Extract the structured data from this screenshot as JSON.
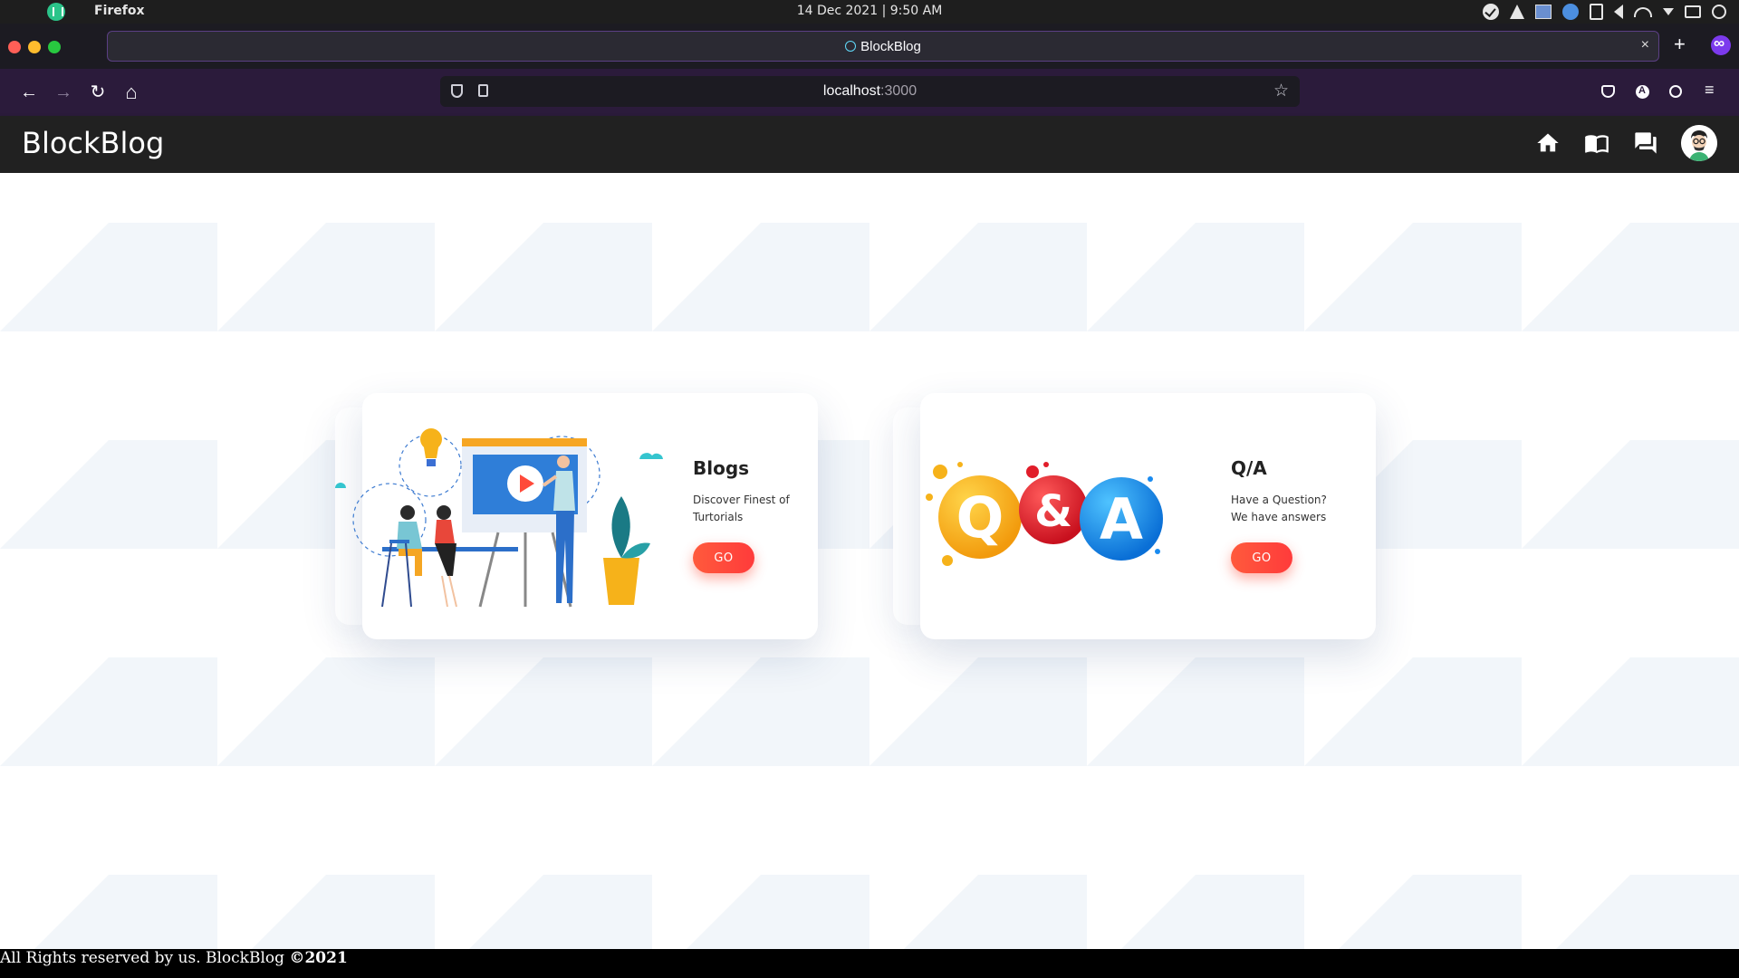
{
  "os": {
    "app_name": "Firefox",
    "clock": "14 Dec 2021 | 9:50 AM",
    "tray_icons": [
      "check-circle-icon",
      "vlc-cone-icon",
      "image-icon",
      "globe-icon",
      "clipboard-icon",
      "volume-icon",
      "wifi-icon",
      "dropdown-arrow-icon",
      "keyboard-icon",
      "power-icon"
    ]
  },
  "browser": {
    "tab_title": "BlockBlog",
    "tab_close": "×",
    "new_tab": "+",
    "url_host": "localhost",
    "url_port": ":3000",
    "back": "←",
    "forward": "→",
    "reload": "↻",
    "home": "⌂",
    "star": "☆",
    "menu": "≡"
  },
  "header": {
    "brand": "BlockBlog",
    "nav_icons": [
      "home-icon",
      "book-icon",
      "forum-icon",
      "avatar"
    ]
  },
  "cards": [
    {
      "title": "Blogs",
      "description": "Discover Finest of Turtorials",
      "button": "GO",
      "illustration": "presentation-meeting-illustration"
    },
    {
      "title": "Q/A",
      "description": "Have a Question? We have answers",
      "button": "GO",
      "illustration": "q-and-a-bubbles-illustration"
    }
  ],
  "qa_letters": {
    "q": "Q",
    "amp": "&",
    "a": "A"
  },
  "footer": {
    "text": "All Rights reserved by us. BlockBlog ",
    "bold": "©2021"
  },
  "colors": {
    "header_bg": "#212121",
    "go_button": "#ff4a3a",
    "browser_tabstrip": "#1c1b22",
    "browser_toolbar": "#2b1b3b"
  }
}
